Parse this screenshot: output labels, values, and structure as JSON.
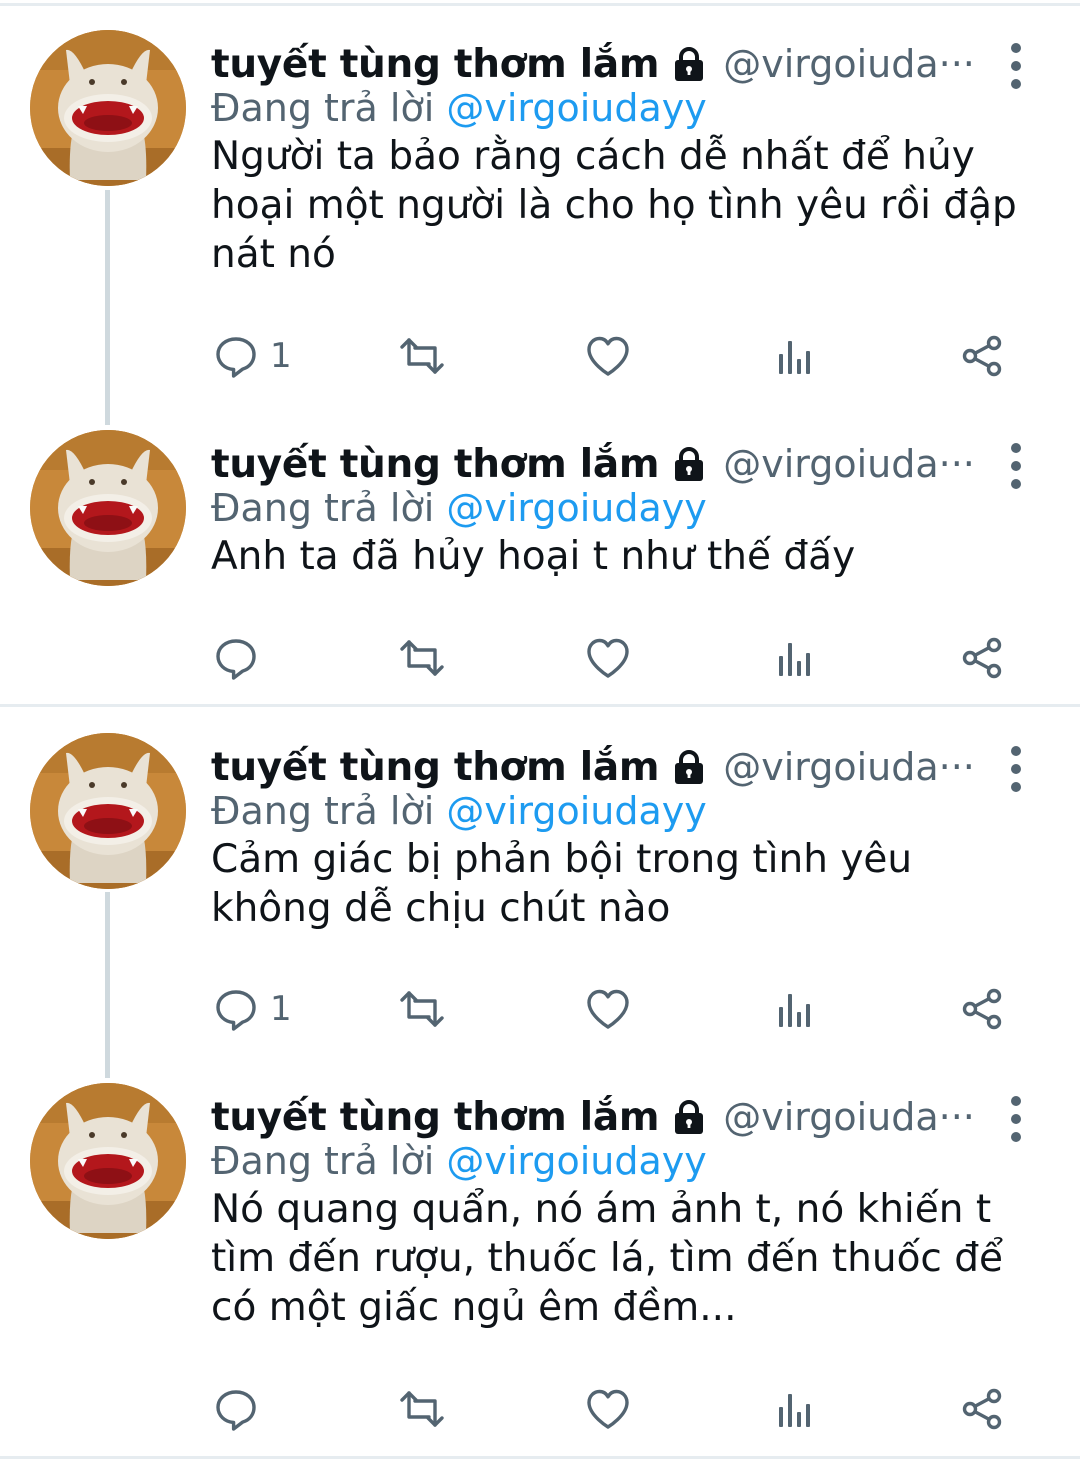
{
  "tweets": [
    {
      "display_name": "tuyết tùng thơm lắm",
      "handle": "@virgoiuda···",
      "reply_prefix": "Đang trả lời",
      "reply_mention": "@virgoiudayy",
      "lines": [
        "Người ta bảo rằng cách dễ nhất để hủy",
        "hoại một người là cho họ tình yêu rồi đập",
        "nát nó"
      ],
      "reply_count": "1"
    },
    {
      "display_name": "tuyết tùng thơm lắm",
      "handle": "@virgoiuda···",
      "reply_prefix": "Đang trả lời",
      "reply_mention": "@virgoiudayy",
      "lines": [
        "Anh ta đã hủy hoại t như thế đấy"
      ],
      "reply_count": ""
    },
    {
      "display_name": "tuyết tùng thơm lắm",
      "handle": "@virgoiuda···",
      "reply_prefix": "Đang trả lời",
      "reply_mention": "@virgoiudayy",
      "lines": [
        "Cảm giác bị phản bội trong tình yêu",
        "không dễ chịu chút nào"
      ],
      "reply_count": "1"
    },
    {
      "display_name": "tuyết tùng thơm lắm",
      "handle": "@virgoiuda···",
      "reply_prefix": "Đang trả lời",
      "reply_mention": "@virgoiudayy",
      "lines": [
        "Nó quang quẩn, nó ám ảnh t, nó khiến t",
        "tìm đến rượu, thuốc lá, tìm đến thuốc để",
        "có một giấc ngủ êm đềm..."
      ],
      "reply_count": ""
    }
  ],
  "icons": {
    "protected": "lock-icon",
    "more": "more-vertical-icon",
    "reply": "reply-bubble-icon",
    "retweet": "retweet-icon",
    "like": "heart-icon",
    "analytics": "analytics-bars-icon",
    "share": "share-icon"
  },
  "colors": {
    "text": "#0f1419",
    "secondary": "#536471",
    "mention": "#1d9bf0",
    "separator": "#e6ecf0",
    "thread_line": "#cfd9de"
  }
}
